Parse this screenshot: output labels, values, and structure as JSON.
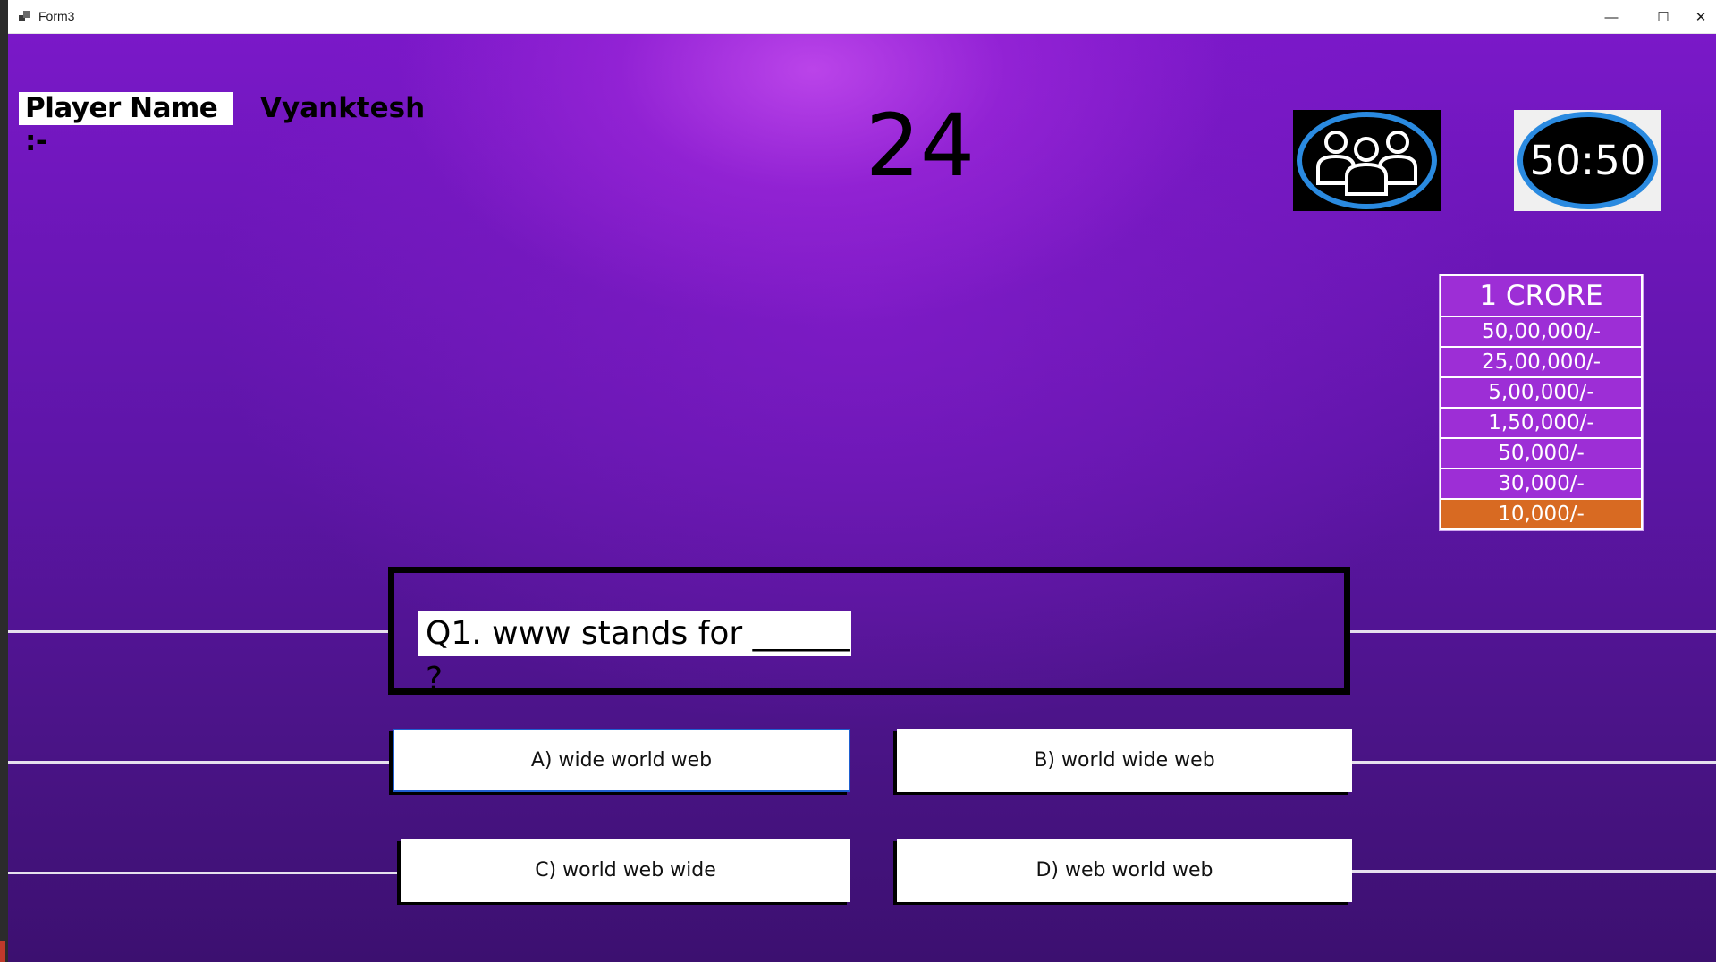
{
  "window": {
    "title": "Form3",
    "minimize_glyph": "—",
    "maximize_glyph": "☐",
    "close_glyph": "✕"
  },
  "player": {
    "label": "Player Name :-",
    "name": "Vyanktesh"
  },
  "timer": "24",
  "lifelines": {
    "audience": {
      "icon": "audience-poll-icon"
    },
    "fifty_fifty": {
      "label": "50:50"
    }
  },
  "prize_ladder": [
    "1 CRORE",
    "50,00,000/-",
    "25,00,000/-",
    "5,00,000/-",
    "1,50,000/-",
    "50,000/-",
    "30,000/-",
    "10,000/-"
  ],
  "question": "Q1. www stands for ______ ?",
  "options": {
    "a": "A) wide world web",
    "b": "B) world wide web",
    "c": "C) world web wide",
    "d": "D) web world web"
  },
  "colors": {
    "ladder_row": "#9d2ed6",
    "ladder_current": "#d86a22",
    "lifeline_ring": "#2a8ae0",
    "selected_option_border": "#1f5fd0"
  }
}
